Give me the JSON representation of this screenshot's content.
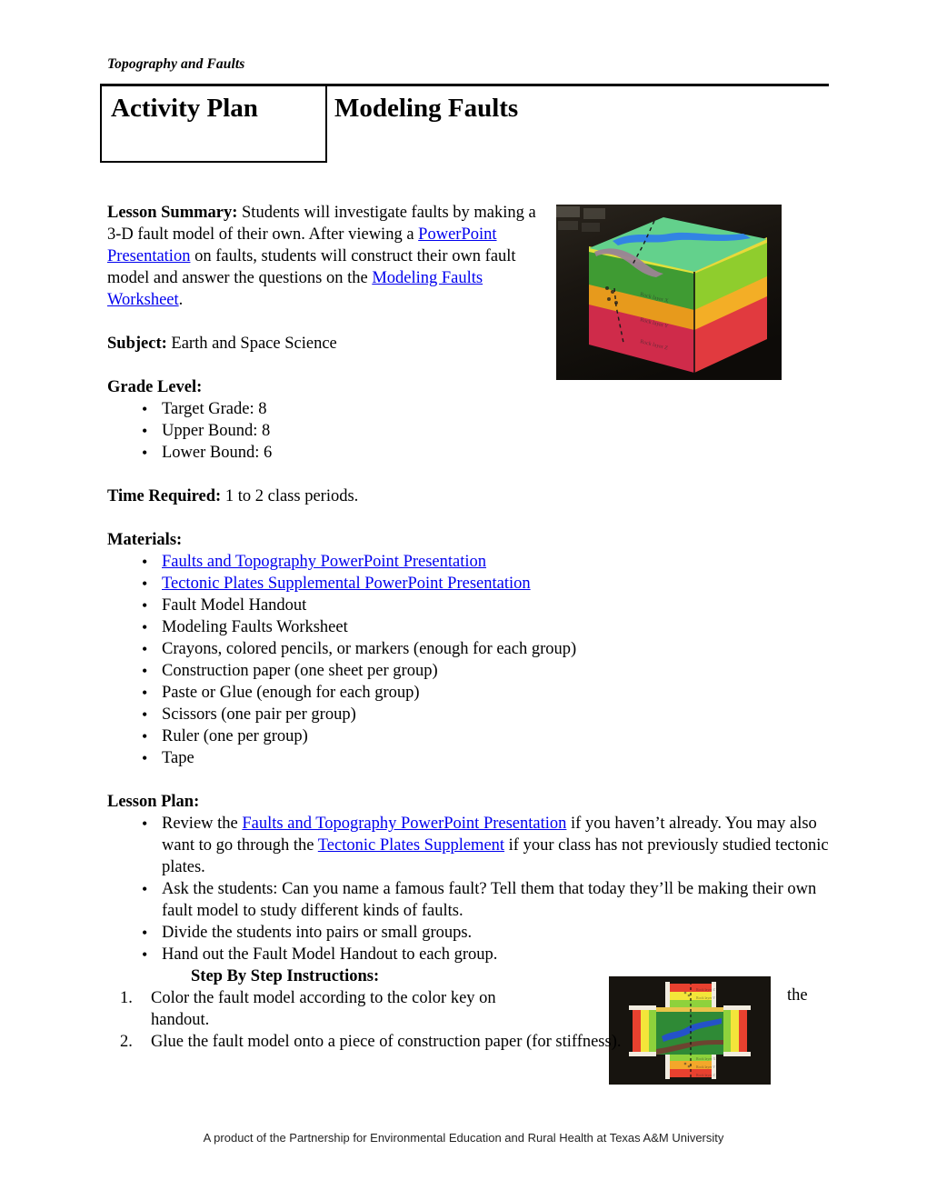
{
  "header": {
    "running_head": "Topography and Faults",
    "doc_type": "Activity Plan",
    "title": "Modeling Faults"
  },
  "summary": {
    "label": "Lesson Summary:",
    "text_1": " Students will investigate faults by making a 3-D fault model of their own.  After viewing a ",
    "link_1": "PowerPoint Presentation",
    "text_2": " on faults, students will construct their own fault model and answer the questions on the ",
    "link_2": "Modeling Faults Worksheet",
    "text_3": "."
  },
  "subject": {
    "label": "Subject:",
    "value": " Earth and Space Science"
  },
  "grade_level": {
    "label": "Grade Level:",
    "items": [
      "Target Grade: 8",
      "Upper Bound: 8",
      "Lower Bound: 6"
    ]
  },
  "time_required": {
    "label": "Time Required:",
    "value": " 1 to 2 class periods."
  },
  "materials": {
    "label": "Materials:",
    "items": [
      {
        "text": "Faults and Topography PowerPoint Presentation",
        "link": true
      },
      {
        "text": "Tectonic Plates Supplemental PowerPoint Presentation",
        "link": true
      },
      {
        "text": "Fault Model Handout",
        "link": false
      },
      {
        "text": "Modeling Faults Worksheet",
        "link": false
      },
      {
        "text": "Crayons, colored pencils, or markers (enough for each group)",
        "link": false
      },
      {
        "text": "Construction paper (one sheet per group)",
        "link": false
      },
      {
        "text": "Paste or Glue (enough for each group)",
        "link": false
      },
      {
        "text": "Scissors (one pair per group)",
        "link": false
      },
      {
        "text": "Ruler (one per group)",
        "link": false
      },
      {
        "text": "Tape",
        "link": false
      }
    ]
  },
  "lesson_plan": {
    "label": "Lesson Plan:",
    "bullet_1": {
      "text_1": "Review the ",
      "link_1": "Faults and Topography PowerPoint Presentation",
      "text_2": " if you haven’t already.  You may also want to go through the ",
      "link_2": "Tectonic Plates Supplement",
      "text_3": " if your class has not previously studied tectonic plates."
    },
    "bullet_2": "Ask the students: Can you name a famous fault?  Tell them that today they’ll be making their own fault model to study different kinds of faults.",
    "bullet_3": "Divide the students into pairs or small groups.",
    "bullet_4": "Hand out the Fault Model Handout to each group.",
    "step_by_step": {
      "label": "Step By Step Instructions:",
      "steps": [
        "Color the fault model according to the color key on",
        "Glue the fault model onto a piece of construction paper (for stiffness)."
      ],
      "step_1_continuation": "handout.",
      "wrapped_word": "the"
    }
  },
  "photos": [
    {
      "name": "fault-model-3d",
      "alt": "Assembled 3-D paper fault model box with green top showing a blue river and brown road, and layered green, orange and red rock strata on the sides",
      "colors": {
        "background": "#1a1713",
        "top_surface": "#5fd38a",
        "layer_green": "#4caa3a",
        "layer_yellow_green": "#9ad62e",
        "layer_orange": "#f2a61e",
        "layer_red": "#d4294a",
        "river": "#2d7fe0",
        "road": "#9a8090"
      }
    },
    {
      "name": "fault-model-net",
      "alt": "Flat cross-shaped paper net of the fault model, colored with red, orange, yellow and green strata and a green map face with blue river and brown road",
      "colors": {
        "background": "#17140f",
        "map_green": "#2f8a36",
        "band_light_green": "#8ed23c",
        "band_yellow": "#f3e53a",
        "band_orange": "#f4a72a",
        "band_red": "#e8412f",
        "river": "#2452c9",
        "road": "#6d4430"
      }
    }
  ],
  "footer": {
    "text": "A product of the Partnership for Environmental Education and Rural Health at Texas A&M University"
  }
}
